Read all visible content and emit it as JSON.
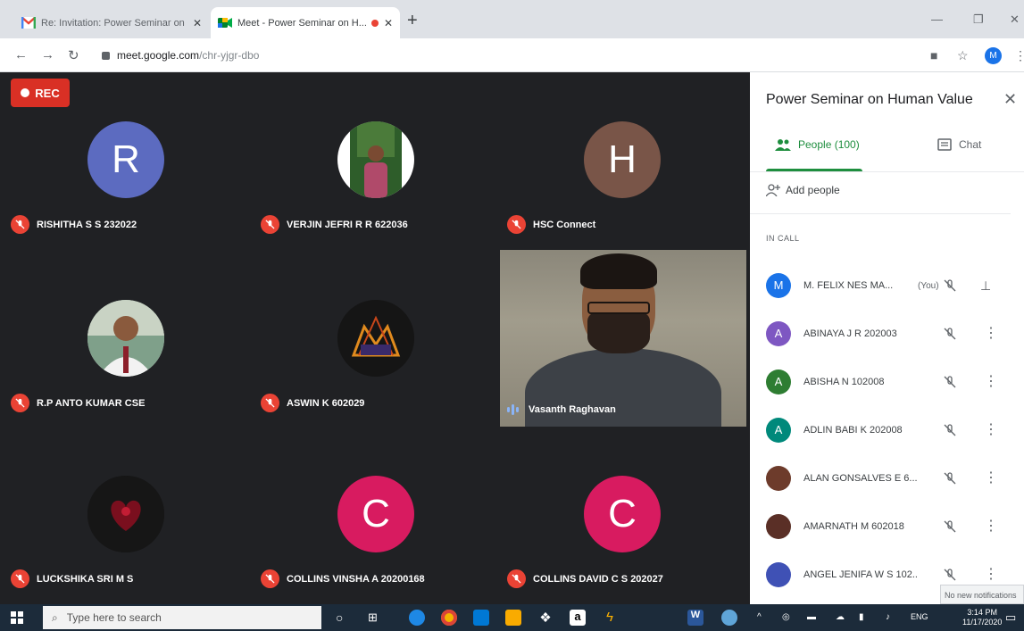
{
  "browser": {
    "tabs": [
      {
        "title": "Re: Invitation: Power Seminar on ...",
        "icon": "gmail-icon",
        "active": false
      },
      {
        "title": "Meet - Power Seminar on H...",
        "icon": "meet-icon",
        "active": true
      }
    ],
    "url_host": "meet.google.com",
    "url_path": "/chr-yjgr-dbo",
    "profile_initial": "M"
  },
  "meet": {
    "rec_label": "REC",
    "tiles": [
      {
        "name": "RISHITHA S S 232022",
        "initial": "R",
        "color": "#5c6bc0",
        "kind": "letter"
      },
      {
        "name": "VERJIN JEFRI R R 622036",
        "initial": "",
        "color": "#ffffff",
        "kind": "photo"
      },
      {
        "name": "HSC Connect",
        "initial": "H",
        "color": "#795548",
        "kind": "letter"
      },
      {
        "name": "R.P ANTO KUMAR CSE",
        "initial": "",
        "color": "#d6d8dc",
        "kind": "photo"
      },
      {
        "name": "ASWIN K 602029",
        "initial": "",
        "color": "#1a1a1a",
        "kind": "photo"
      },
      {
        "name": "LUCKSHIKA SRI M S",
        "initial": "",
        "color": "#121212",
        "kind": "photo"
      },
      {
        "name": "COLLINS VINSHA A 20200168",
        "initial": "C",
        "color": "#d81b60",
        "kind": "letter"
      },
      {
        "name": "COLLINS DAVID C S 202027",
        "initial": "C",
        "color": "#d81b60",
        "kind": "letter"
      }
    ],
    "speaker_name": "Vasanth Raghavan"
  },
  "panel": {
    "title": "Power Seminar on Human Value",
    "people_tab": "People (100)",
    "chat_tab": "Chat",
    "add_people": "Add people",
    "in_call_label": "IN CALL",
    "you_label": "(You)",
    "participants": [
      {
        "name": "M. FELIX NES MA...",
        "initial": "M",
        "color": "#1a73e8",
        "you": true
      },
      {
        "name": "ABINAYA J R 202003",
        "initial": "A",
        "color": "#7e57c2",
        "you": false
      },
      {
        "name": "ABISHA N 102008",
        "initial": "A",
        "color": "#2e7d32",
        "you": false
      },
      {
        "name": "ADLIN BABI K 202008",
        "initial": "A",
        "color": "#00897b",
        "you": false
      },
      {
        "name": "ALAN GONSALVES E 6...",
        "initial": "",
        "color": "#6d3b2b",
        "you": false
      },
      {
        "name": "AMARNATH M 602018",
        "initial": "",
        "color": "#5a2f26",
        "you": false
      },
      {
        "name": "ANGEL JENIFA W S 102...",
        "initial": "",
        "color": "#3f51b5",
        "you": false
      }
    ]
  },
  "notification": "No new notifications",
  "taskbar": {
    "search_placeholder": "Type here to search",
    "lang": "ENG",
    "time": "3:14 PM",
    "date": "11/17/2020"
  }
}
